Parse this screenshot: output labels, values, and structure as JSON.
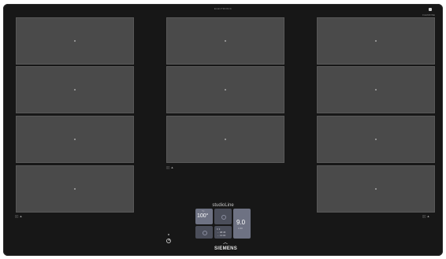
{
  "hob": {
    "top_label": "ELECTRONIC",
    "corner_label": "FLEXZONE",
    "brand_line": "studioLine",
    "logo": "SIEMENS"
  },
  "zones": {
    "left_count": 4,
    "center_count": 3,
    "right_count": 4
  },
  "bridge_marks": {
    "left": "▯▯ ▲",
    "center": "▯▯ ▲",
    "right": "▯▯ ▲"
  },
  "control_panel": {
    "temperature": "100°",
    "temperature_tag": "°C",
    "power_level": "9.0",
    "power_sub": "1:00",
    "info_line_1": "≡ 3",
    "info_line_2": "→ 08:45",
    "info_line_3": "→ 13:00"
  },
  "icons": {
    "power": "power-icon",
    "scroll": "chevron-up-icon",
    "lock": "lock-icon",
    "settings": "settings-icon"
  },
  "colors": {
    "surface": "#171717",
    "zone": "#4a4a4a",
    "panel_active": "#6e7283",
    "panel_tile": "#4b4e5a"
  }
}
